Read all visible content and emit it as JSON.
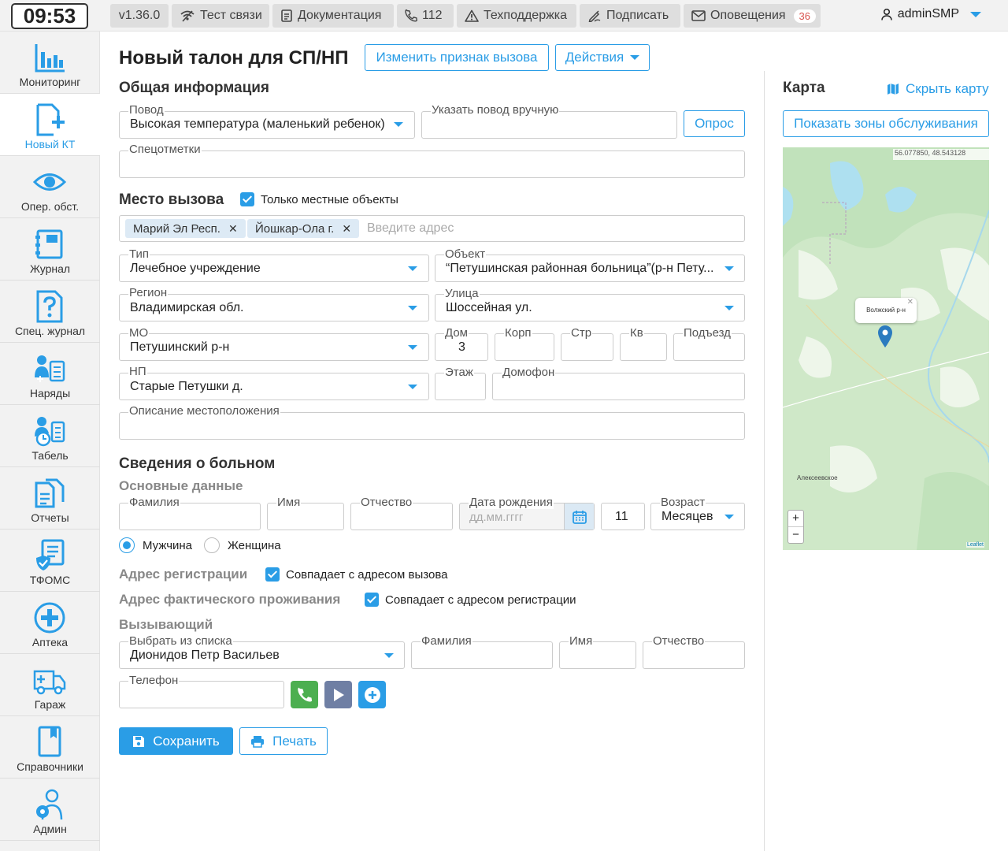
{
  "header": {
    "clock": "09:53",
    "version": "v1.36.0",
    "test_conn": "Тест связи",
    "docs": "Документация",
    "phone": "112",
    "support": "Техподдержка",
    "sign": "Подписать",
    "notifications": "Оповещения",
    "notifications_count": "36",
    "user": "adminSMP"
  },
  "sidebar": {
    "items": [
      {
        "label": "Мониторинг",
        "icon": "chart-bars-icon"
      },
      {
        "label": "Новый КТ",
        "icon": "new-document-icon"
      },
      {
        "label": "Опер. обст.",
        "icon": "eye-icon"
      },
      {
        "label": "Журнал",
        "icon": "journal-icon"
      },
      {
        "label": "Спец. журнал",
        "icon": "question-document-icon"
      },
      {
        "label": "Наряды",
        "icon": "team-list-icon"
      },
      {
        "label": "Табель",
        "icon": "timesheet-icon"
      },
      {
        "label": "Отчеты",
        "icon": "reports-icon"
      },
      {
        "label": "ТФОМС",
        "icon": "shield-document-icon"
      },
      {
        "label": "Аптека",
        "icon": "pharmacy-cross-icon"
      },
      {
        "label": "Гараж",
        "icon": "ambulance-icon"
      },
      {
        "label": "Справочники",
        "icon": "book-icon"
      },
      {
        "label": "Админ",
        "icon": "admin-gear-icon"
      }
    ]
  },
  "page": {
    "title": "Новый талон для СП/НП",
    "change_sign_button": "Изменить признак вызова",
    "actions_button": "Действия"
  },
  "general": {
    "title": "Общая информация",
    "reason_label": "Повод",
    "reason_value": "Высокая температура (маленький ребенок)",
    "manual_reason_label": "Указать повод вручную",
    "survey_button": "Опрос",
    "special_marks_label": "Спецотметки"
  },
  "place": {
    "title": "Место вызова",
    "local_only": "Только местные объекты",
    "tags": [
      "Марий Эл Респ.",
      "Йошкар-Ола г."
    ],
    "address_placeholder": "Введите адрес",
    "type_label": "Тип",
    "type_value": "Лечебное учреждение",
    "object_label": "Объект",
    "object_value": "“Петушинская районная больница”(р-н Пету...",
    "region_label": "Регион",
    "region_value": "Владимирская обл.",
    "street_label": "Улица",
    "street_value": "Шоссейная ул.",
    "mo_label": "МО",
    "mo_value": "Петушинский р-н",
    "house_label": "Дом",
    "house_value": "3",
    "korp_label": "Корп",
    "str_label": "Стр",
    "kv_label": "Кв",
    "entrance_label": "Подъезд",
    "np_label": "НП",
    "np_value": "Старые Петушки д.",
    "floor_label": "Этаж",
    "intercom_label": "Домофон",
    "location_desc_label": "Описание местоположения"
  },
  "patient": {
    "title": "Сведения о больном",
    "basic_title": "Основные данные",
    "surname_label": "Фамилия",
    "name_label": "Имя",
    "patronymic_label": "Отчество",
    "birth_label": "Дата рождения",
    "birth_placeholder": "дд.мм.гггг",
    "age_number": "11",
    "age_label": "Возраст",
    "age_unit": "Месяцев",
    "male": "Мужчина",
    "female": "Женщина",
    "reg_title": "Адрес регистрации",
    "reg_same": "Совпадает с адресом вызова",
    "fact_title": "Адрес фактического проживания",
    "fact_same": "Совпадает с адресом регистрации"
  },
  "caller": {
    "title": "Вызывающий",
    "select_label": "Выбрать из списка",
    "select_value": "Дионидов Петр Васильев",
    "surname_label": "Фамилия",
    "name_label": "Имя",
    "patronymic_label": "Отчество",
    "phone_label": "Телефон"
  },
  "footer": {
    "save": "Сохранить",
    "print": "Печать"
  },
  "map": {
    "title": "Карта",
    "hide": "Скрыть карту",
    "zones_button": "Показать зоны обслуживания",
    "coords": "56.077850, 48.543128",
    "popup": "Волжский р-н",
    "place_label": "Алексеевское",
    "zoom_in": "+",
    "zoom_out": "−",
    "attribution": "Leaflet"
  },
  "colors": {
    "accent": "#2a9de6",
    "phone_button": "#4caf50",
    "play_button": "#6f7fa4"
  }
}
